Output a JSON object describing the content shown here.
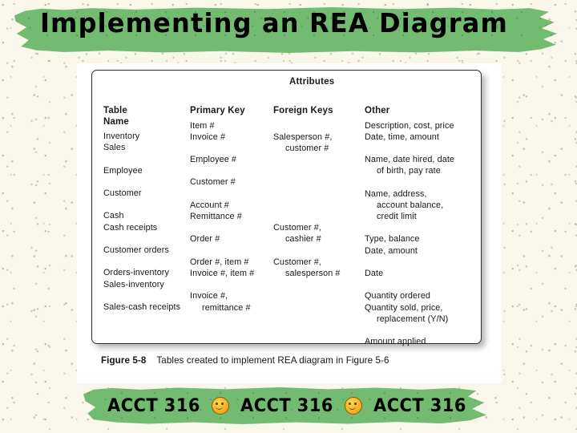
{
  "slide": {
    "title": "Implementing an REA Diagram"
  },
  "figure": {
    "attributes_label": "Attributes",
    "columns": [
      {
        "key": "table_name",
        "header": "Table\nName"
      },
      {
        "key": "primary_key",
        "header": "Primary Key"
      },
      {
        "key": "foreign_keys",
        "header": "Foreign Keys"
      },
      {
        "key": "other",
        "header": "Other"
      }
    ],
    "groups": [
      {
        "table_name": [
          "Inventory",
          "Sales"
        ],
        "primary_key": [
          "Item #",
          "Invoice #"
        ],
        "foreign_keys": [
          "",
          "Salesperson #,|customer #"
        ],
        "other": [
          "Description, cost, price",
          "Date, time, amount"
        ]
      },
      {
        "table_name": [
          "Employee"
        ],
        "primary_key": [
          "Employee #"
        ],
        "foreign_keys": [
          ""
        ],
        "other": [
          "Name, date hired, date|of birth, pay rate"
        ]
      },
      {
        "table_name": [
          "Customer"
        ],
        "primary_key": [
          "Customer #"
        ],
        "foreign_keys": [
          ""
        ],
        "other": [
          "Name, address,|account balance,|credit limit"
        ]
      },
      {
        "table_name": [
          "Cash",
          "Cash receipts"
        ],
        "primary_key": [
          "Account #",
          "Remittance #"
        ],
        "foreign_keys": [
          "",
          "Customer #,|cashier #"
        ],
        "other": [
          "Type, balance",
          "Date, amount"
        ]
      },
      {
        "table_name": [
          "Customer orders"
        ],
        "primary_key": [
          "Order #"
        ],
        "foreign_keys": [
          "Customer #,|salesperson #"
        ],
        "other": [
          "Date"
        ]
      },
      {
        "table_name": [
          "Orders-inventory",
          "Sales-inventory"
        ],
        "primary_key": [
          "Order #, item #",
          "Invoice #, item #"
        ],
        "foreign_keys": [
          "",
          ""
        ],
        "other": [
          "Quantity ordered",
          "Quantity sold, price,|replacement (Y/N)"
        ]
      },
      {
        "table_name": [
          "Sales-cash receipts"
        ],
        "primary_key": [
          "Invoice #,|remittance #"
        ],
        "foreign_keys": [
          ""
        ],
        "other": [
          "Amount applied"
        ]
      }
    ],
    "caption_label": "Figure 5-8",
    "caption_text": "Tables created to implement REA diagram in Figure 5-6"
  },
  "footer": {
    "items": [
      {
        "type": "label",
        "text": "ACCT 316"
      },
      {
        "type": "icon",
        "name": "smiley-face-icon"
      },
      {
        "type": "label",
        "text": "ACCT 316"
      },
      {
        "type": "icon",
        "name": "smiley-face-icon"
      },
      {
        "type": "label",
        "text": "ACCT 316"
      }
    ]
  },
  "colors": {
    "banner_green": "#74bb72",
    "paper_cream": "#f8f7ea",
    "panel_white": "#ffffff",
    "text_black": "#000000",
    "smiley_gold": "#f0a81f"
  }
}
